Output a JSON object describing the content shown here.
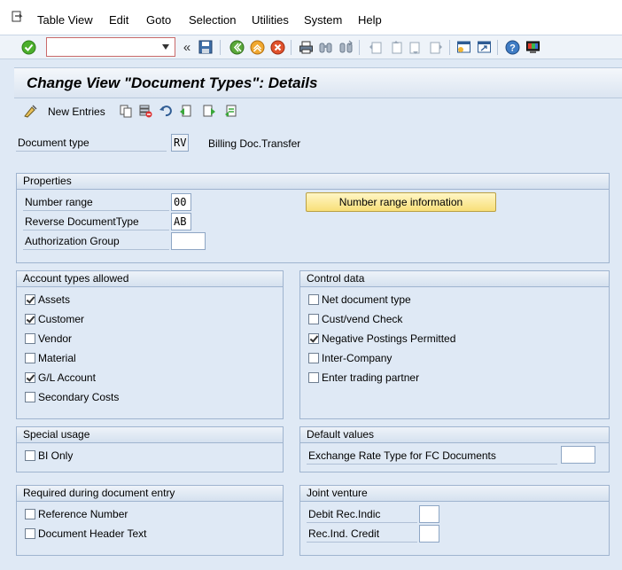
{
  "menu": {
    "items": [
      {
        "label": "Table View"
      },
      {
        "label": "Edit"
      },
      {
        "label": "Goto"
      },
      {
        "label": "Selection"
      },
      {
        "label": "Utilities"
      },
      {
        "label": "System"
      },
      {
        "label": "Help"
      }
    ]
  },
  "toolbar": {
    "command_value": "",
    "icons": [
      "enter-icon",
      "save-icon",
      "back-icon",
      "exit-icon",
      "cancel-icon",
      "print-icon",
      "find-icon",
      "find-next-icon",
      "first-page-icon",
      "previous-page-icon",
      "next-page-icon",
      "last-page-icon",
      "create-session-icon",
      "shortcut-icon",
      "help-icon",
      "customize-layout-icon"
    ]
  },
  "title": "Change View \"Document Types\": Details",
  "app_toolbar": {
    "new_entries_label": "New Entries"
  },
  "header": {
    "document_type_label": "Document type",
    "document_type_value": "RV",
    "document_type_text": "Billing Doc.Transfer"
  },
  "properties": {
    "title": "Properties",
    "number_range_label": "Number range",
    "number_range_value": "00",
    "reverse_doc_type_label": "Reverse DocumentType",
    "reverse_doc_type_value": "AB",
    "auth_group_label": "Authorization Group",
    "auth_group_value": "",
    "number_range_button": "Number range information"
  },
  "account_types": {
    "title": "Account types allowed",
    "items": [
      {
        "label": "Assets",
        "checked": true
      },
      {
        "label": "Customer",
        "checked": true
      },
      {
        "label": "Vendor",
        "checked": false
      },
      {
        "label": "Material",
        "checked": false
      },
      {
        "label": "G/L Account",
        "checked": true
      },
      {
        "label": "Secondary Costs",
        "checked": false
      }
    ]
  },
  "control_data": {
    "title": "Control data",
    "items": [
      {
        "label": "Net document type",
        "checked": false
      },
      {
        "label": "Cust/vend Check",
        "checked": false
      },
      {
        "label": "Negative Postings Permitted",
        "checked": true
      },
      {
        "label": "Inter-Company",
        "checked": false
      },
      {
        "label": "Enter trading partner",
        "checked": false
      }
    ]
  },
  "special_usage": {
    "title": "Special usage",
    "bi_only_label": "BI Only",
    "bi_only_checked": false
  },
  "default_values": {
    "title": "Default values",
    "exchange_rate_label": "Exchange Rate Type for FC Documents",
    "exchange_rate_value": ""
  },
  "required_entry": {
    "title": "Required during document entry",
    "reference_number_label": "Reference Number",
    "reference_number_checked": false,
    "doc_header_text_label": "Document Header Text",
    "doc_header_text_checked": false
  },
  "joint_venture": {
    "title": "Joint venture",
    "debit_label": "Debit Rec.Indic",
    "debit_value": "",
    "credit_label": "Rec.Ind. Credit",
    "credit_value": ""
  }
}
